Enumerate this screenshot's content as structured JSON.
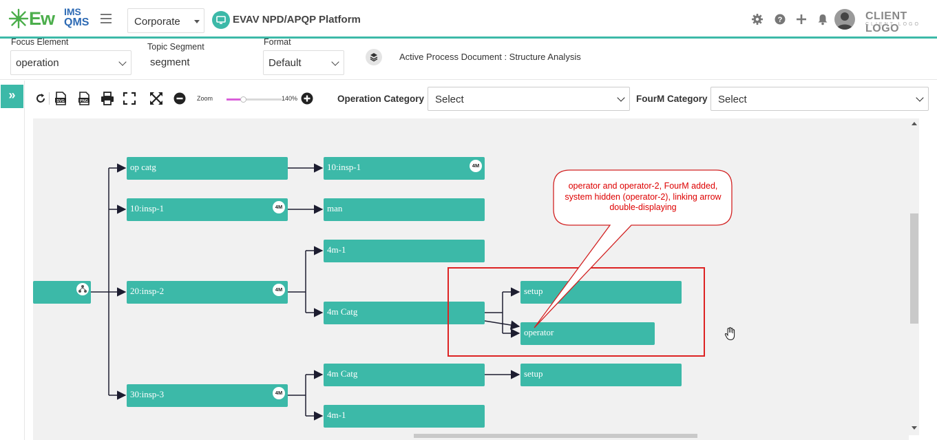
{
  "header": {
    "logo": {
      "primary": "Ew",
      "top": "IMS",
      "bottom": "QMS"
    },
    "org_select": "Corporate",
    "platform_title": "EVAV NPD/APQP Platform",
    "client_logo": "CLIENT LOGO",
    "client_logo_sub": "CLIENT LOGO"
  },
  "filters": {
    "focus_element": {
      "label": "Focus Element",
      "value": "operation"
    },
    "topic_segment": {
      "label": "Topic Segment",
      "value": "segment"
    },
    "format": {
      "label": "Format",
      "value": "Default"
    },
    "active_document": "Active Process Document : Structure Analysis"
  },
  "rail": {
    "expand_label": "»"
  },
  "toolbar": {
    "zoom_label": "Zoom",
    "zoom_value": "140%",
    "zoom_level": 0.3,
    "operation_category": {
      "label": "Operation Category",
      "value": "Select"
    },
    "fourm_category": {
      "label": "FourM Category",
      "value": "Select"
    }
  },
  "tree": {
    "root": {
      "label": ""
    },
    "level1": [
      {
        "label": "op catg",
        "badge": ""
      },
      {
        "label": "10:insp-1",
        "badge": "4M"
      },
      {
        "label": "20:insp-2",
        "badge": "4M"
      },
      {
        "label": "30:insp-3",
        "badge": "4M"
      }
    ],
    "level2": [
      {
        "label": "10:insp-1",
        "badge": "4M"
      },
      {
        "label": "man",
        "badge": ""
      },
      {
        "label": "4m-1",
        "badge": ""
      },
      {
        "label": "4m Catg",
        "badge": ""
      },
      {
        "label": "4m Catg",
        "badge": ""
      },
      {
        "label": "4m-1",
        "badge": ""
      }
    ],
    "level3": [
      {
        "label": "setup"
      },
      {
        "label": "operator"
      },
      {
        "label": "setup"
      }
    ]
  },
  "annotation": {
    "callout": "operator and operator-2, FourM added, system hidden (operator-2), linking arrow double-displaying"
  },
  "colors": {
    "accent": "#3cb9a8",
    "annotation_red": "#d22222",
    "slider_fill": "#d95fd9"
  }
}
